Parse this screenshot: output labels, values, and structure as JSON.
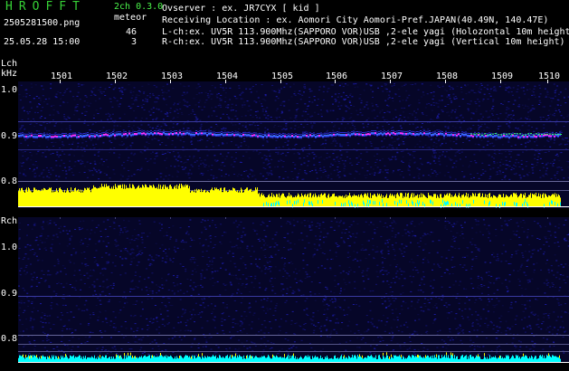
{
  "header": {
    "logo": "HROFFT",
    "version": "2ch 0.3.0",
    "filename": "2505281500.png",
    "meteor_label": "meteor",
    "meteor_lch": "46",
    "meteor_rch": "3",
    "datetime": "25.05.28 15:00"
  },
  "info": {
    "observer": "Ovserver             : ex. JR7CYX [ kid ]",
    "location": "Receiving Location : ex. Aomori City Aomori-Pref.JAPAN(40.49N, 140.47E)",
    "lch": "L-ch:ex. UV5R 113.900Mhz(SAPPORO VOR)USB ,2-ele yagi (Holozontal 10m height)",
    "rch": "R-ch:ex. UV5R 113.900Mhz(SAPPORO VOR)USB ,2-ele yagi (Vertical 10m height)"
  },
  "lch_panel": {
    "label": "Lch",
    "unit": "kHz",
    "y_ticks": [
      "1.0",
      "0.9",
      "0.8"
    ]
  },
  "rch_panel": {
    "label": "Rch",
    "y_ticks": [
      "1.0",
      "0.9",
      "0.8"
    ]
  },
  "x_ticks": [
    "1501",
    "1502",
    "1503",
    "1504",
    "1505",
    "1506",
    "1507",
    "1508",
    "1509",
    "1510"
  ],
  "colors": {
    "background": "#000000",
    "spectrum_noise": "#0a0a5a",
    "signal": "#ff00ff",
    "level_meter": "#ffff00",
    "level_meter_alt": "#00ffff",
    "logo": "#36d136"
  }
}
